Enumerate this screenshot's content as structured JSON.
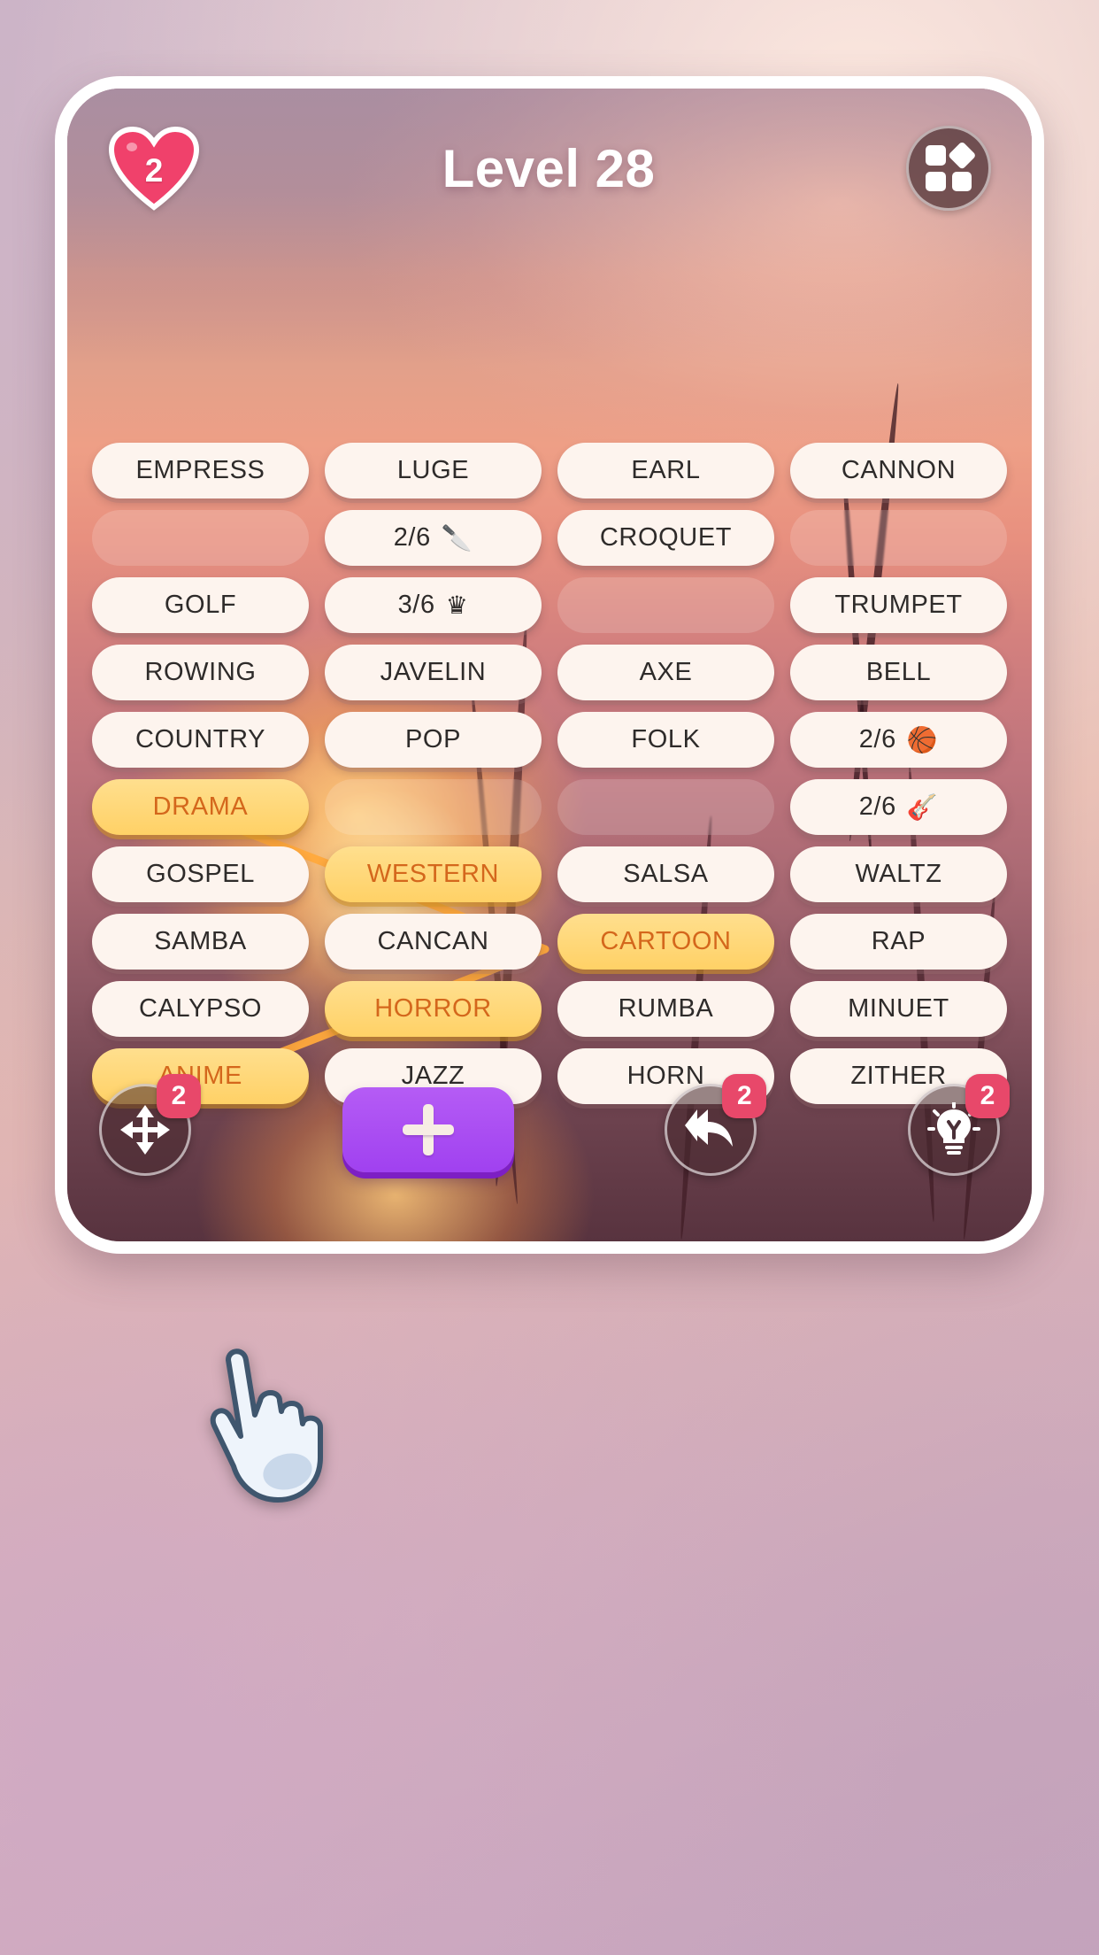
{
  "header": {
    "lives_icon": "heart-icon",
    "lives_count": "2",
    "title": "Level 28",
    "menu_icon": "grid-menu-icon"
  },
  "grid": {
    "columns": 4,
    "rows": [
      [
        {
          "type": "word",
          "label": "EMPRESS"
        },
        {
          "type": "word",
          "label": "LUGE"
        },
        {
          "type": "word",
          "label": "EARL"
        },
        {
          "type": "word",
          "label": "CANNON"
        }
      ],
      [
        {
          "type": "empty",
          "label": ""
        },
        {
          "type": "counter",
          "label": "2/6",
          "icon": "🔪",
          "icon_name": "knife-icon"
        },
        {
          "type": "word",
          "label": "CROQUET"
        },
        {
          "type": "empty",
          "label": ""
        }
      ],
      [
        {
          "type": "word",
          "label": "GOLF"
        },
        {
          "type": "counter",
          "label": "3/6",
          "icon": "♛",
          "icon_name": "crown-icon"
        },
        {
          "type": "empty",
          "label": ""
        },
        {
          "type": "word",
          "label": "TRUMPET"
        }
      ],
      [
        {
          "type": "word",
          "label": "ROWING"
        },
        {
          "type": "word",
          "label": "JAVELIN"
        },
        {
          "type": "word",
          "label": "AXE"
        },
        {
          "type": "word",
          "label": "BELL"
        }
      ],
      [
        {
          "type": "word",
          "label": "COUNTRY"
        },
        {
          "type": "word",
          "label": "POP"
        },
        {
          "type": "word",
          "label": "FOLK"
        },
        {
          "type": "counter",
          "label": "2/6",
          "icon": "🏀",
          "icon_name": "basketball-icon"
        }
      ],
      [
        {
          "type": "found",
          "label": "DRAMA"
        },
        {
          "type": "empty",
          "label": ""
        },
        {
          "type": "empty",
          "label": ""
        },
        {
          "type": "counter",
          "label": "2/6",
          "icon": "🎸",
          "icon_name": "guitar-icon"
        }
      ],
      [
        {
          "type": "word",
          "label": "GOSPEL"
        },
        {
          "type": "found",
          "label": "WESTERN"
        },
        {
          "type": "word",
          "label": "SALSA"
        },
        {
          "type": "word",
          "label": "WALTZ"
        }
      ],
      [
        {
          "type": "word",
          "label": "SAMBA"
        },
        {
          "type": "word",
          "label": "CANCAN"
        },
        {
          "type": "found",
          "label": "CARTOON"
        },
        {
          "type": "word",
          "label": "RAP"
        }
      ],
      [
        {
          "type": "word",
          "label": "CALYPSO"
        },
        {
          "type": "found",
          "label": "HORROR"
        },
        {
          "type": "word",
          "label": "RUMBA"
        },
        {
          "type": "word",
          "label": "MINUET"
        }
      ],
      [
        {
          "type": "found",
          "label": "ANIME"
        },
        {
          "type": "word",
          "label": "JAZZ"
        },
        {
          "type": "word",
          "label": "HORN"
        },
        {
          "type": "word",
          "label": "ZITHER"
        }
      ]
    ]
  },
  "bottom_bar": {
    "shuffle": {
      "icon_name": "move-arrows-icon",
      "badge": "2"
    },
    "add": {
      "icon_name": "plus-icon",
      "label": "+"
    },
    "undo": {
      "icon_name": "undo-arrow-icon",
      "badge": "2"
    },
    "hint": {
      "icon_name": "lightbulb-icon",
      "badge": "2"
    }
  },
  "cursor": {
    "icon_name": "pointing-hand-cursor"
  },
  "colors": {
    "accent_found_bg": "#ffd166",
    "accent_found_text": "#d4671c",
    "tile_bg": "#fdf4ee",
    "badge": "#e8486a",
    "heart": "#f0416b",
    "add_button": "#a041f0",
    "link_line": "#ffa93c"
  }
}
